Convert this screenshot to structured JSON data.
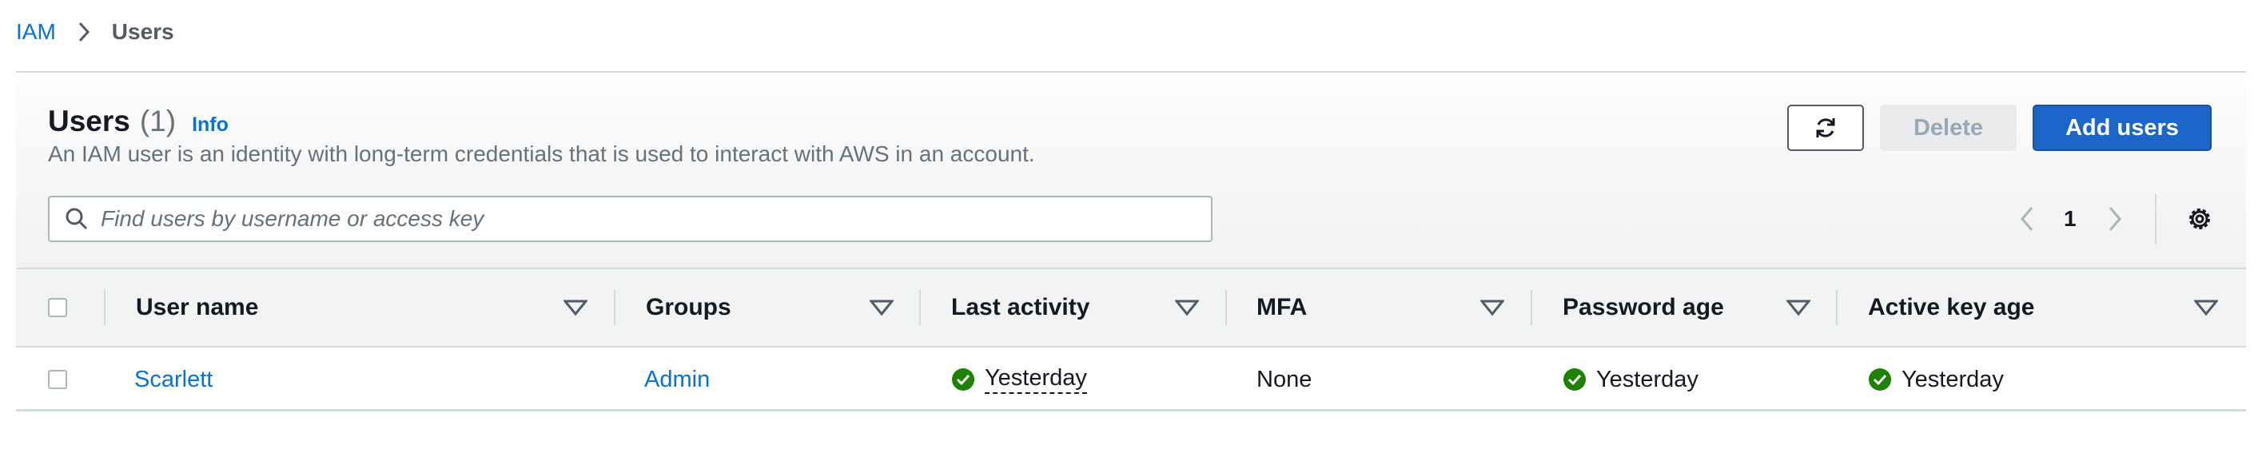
{
  "breadcrumb": {
    "root": "IAM",
    "current": "Users"
  },
  "panel": {
    "title": "Users",
    "count": "(1)",
    "info": "Info",
    "description": "An IAM user is an identity with long-term credentials that is used to interact with AWS in an account."
  },
  "actions": {
    "refresh_icon": "refresh-icon",
    "delete": "Delete",
    "add": "Add users"
  },
  "search": {
    "placeholder": "Find users by username or access key",
    "value": ""
  },
  "pagination": {
    "current_page": "1"
  },
  "table": {
    "columns": [
      "User name",
      "Groups",
      "Last activity",
      "MFA",
      "Password age",
      "Active key age"
    ],
    "rows": [
      {
        "user_name": "Scarlett",
        "groups": "Admin",
        "last_activity": "Yesterday",
        "mfa": "None",
        "password_age": "Yesterday",
        "active_key_age": "Yesterday"
      }
    ]
  },
  "colors": {
    "accent": "#0972d3",
    "primary_button": "#1d66c9",
    "success": "#1d8102",
    "header_bg": "#f2f3f3"
  }
}
